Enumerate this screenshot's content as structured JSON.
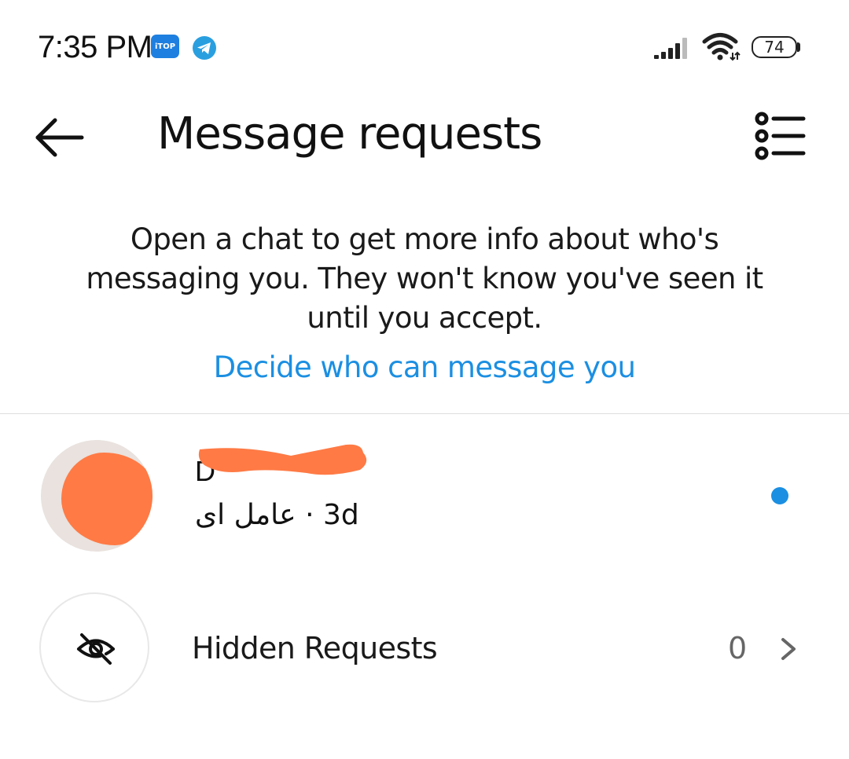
{
  "status_bar": {
    "time": "7:35 PM",
    "itop_label": "iTOP",
    "battery_level": "74",
    "icons": [
      "itop-icon",
      "telegram-icon",
      "signal-icon",
      "wifi-icon",
      "battery-icon"
    ]
  },
  "header": {
    "title": "Message requests",
    "back_icon": "arrow-left-icon",
    "filter_icon": "filter-list-icon"
  },
  "info": {
    "text": "Open a chat to get more info about who's messaging you. They won't know you've seen it until you accept.",
    "link": "Decide who can message you"
  },
  "requests": [
    {
      "name": "D",
      "preview": "عامل ای",
      "separator": "·",
      "time": "3d",
      "unread": true
    }
  ],
  "hidden_requests": {
    "label": "Hidden Requests",
    "count": "0",
    "icon": "eye-off-icon"
  },
  "colors": {
    "accent": "#1b8fe2",
    "redaction": "#ff7a45",
    "divider": "#dedede"
  }
}
